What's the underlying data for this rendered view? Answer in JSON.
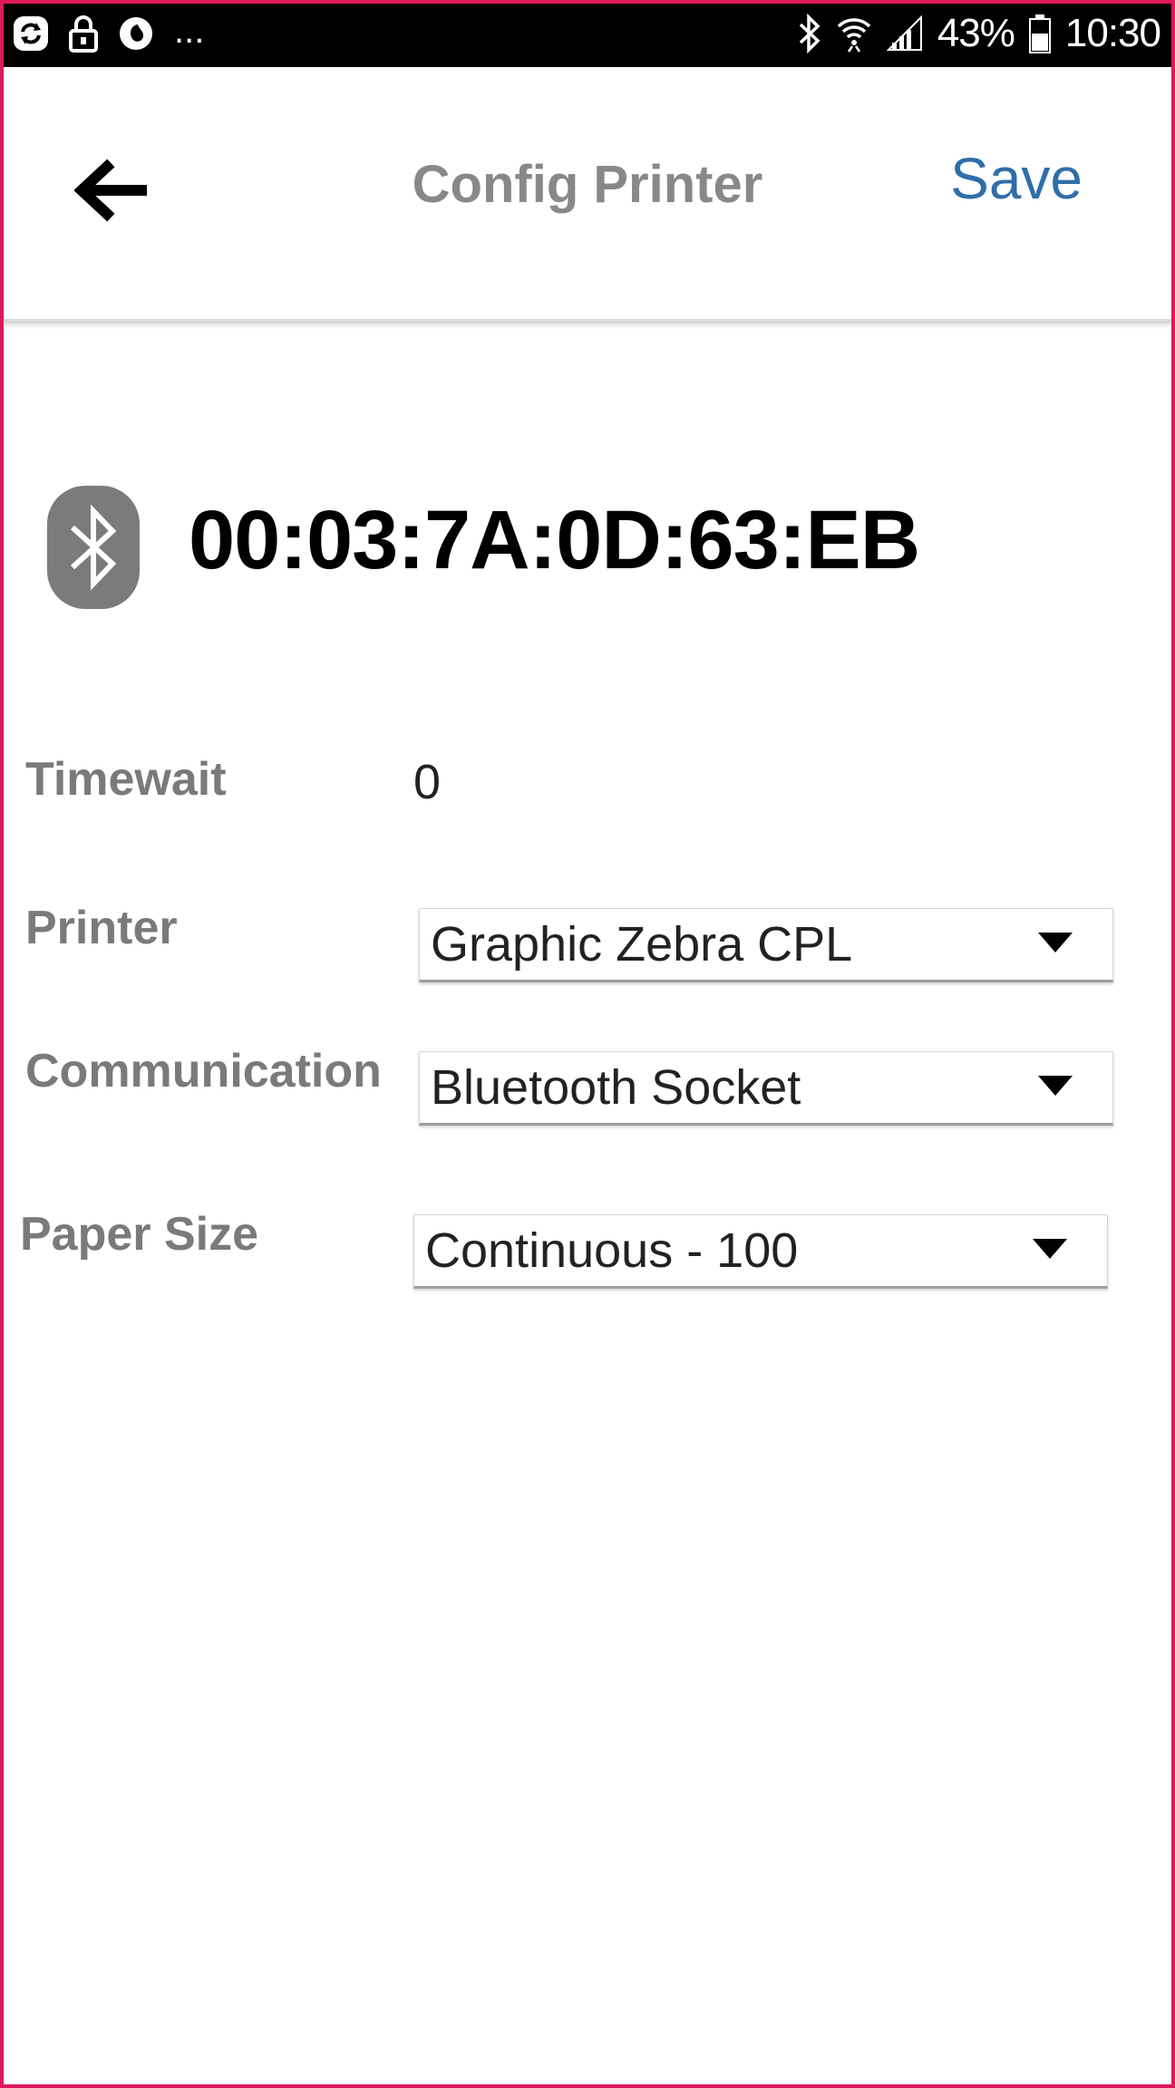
{
  "status_bar": {
    "more_indicator": "...",
    "battery_percent": "43%",
    "time": "10:30",
    "icons": [
      "sync-notification-icon",
      "lock-icon",
      "vodafone-icon",
      "bluetooth-icon",
      "wifi-icon",
      "signal-icon",
      "battery-icon"
    ]
  },
  "header": {
    "title": "Config Printer",
    "save_label": "Save",
    "back_icon": "back-arrow-icon"
  },
  "device": {
    "icon": "bluetooth-icon",
    "address": "00:03:7A:0D:63:EB"
  },
  "form": {
    "timewait": {
      "label": "Timewait",
      "value": "0"
    },
    "printer": {
      "label": "Printer",
      "value": "Graphic Zebra CPL"
    },
    "communication": {
      "label": "Communication",
      "value": "Bluetooth Socket"
    },
    "paper_size": {
      "label": "Paper Size",
      "value": "Continuous - 100"
    }
  },
  "colors": {
    "accent": "#2f6ea8",
    "frame": "#e0185a",
    "label_gray": "#7a7a7a",
    "badge_gray": "#7b7b7b"
  }
}
